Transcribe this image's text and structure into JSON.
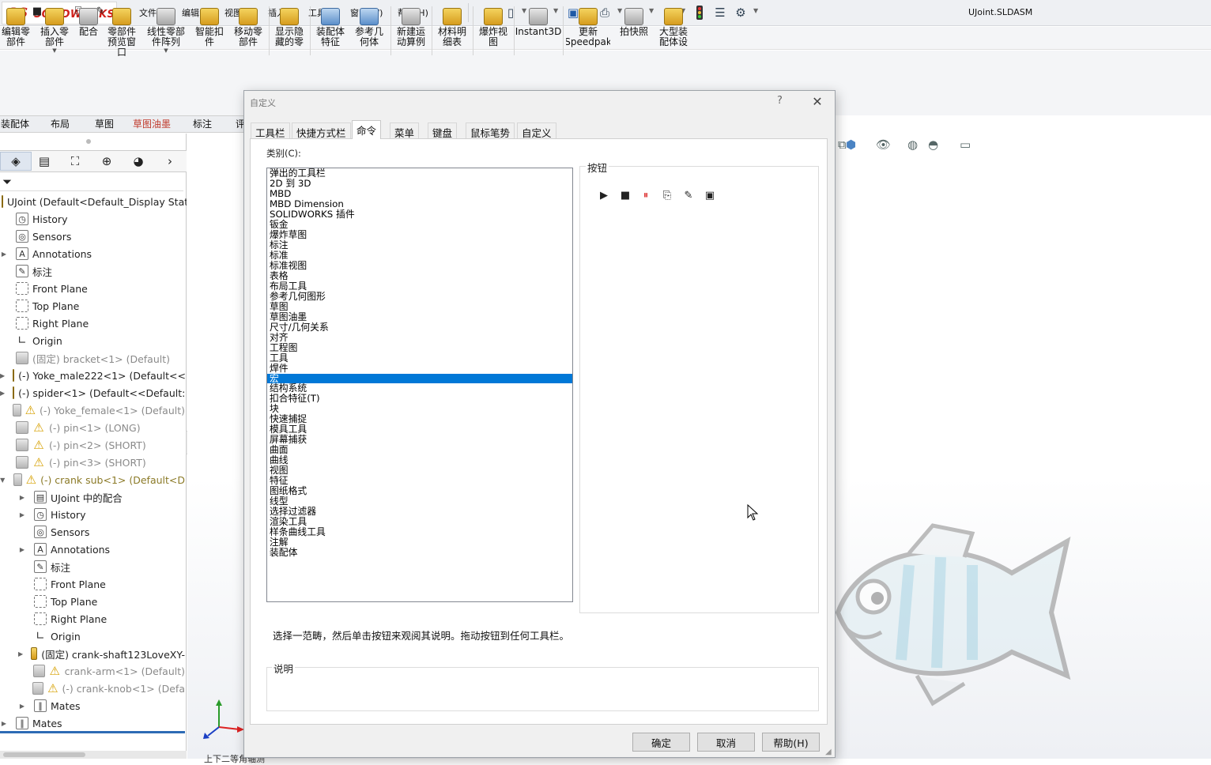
{
  "app": {
    "logo_ds": "3S",
    "logo_text": "SOLIDWORKS",
    "file_title": "UJoint.SLDASM"
  },
  "menu": [
    {
      "label": "文件(F)"
    },
    {
      "label": "编辑(E)"
    },
    {
      "label": "视图(V)"
    },
    {
      "label": "插入(I)"
    },
    {
      "label": "工具(T)"
    },
    {
      "label": "窗口(W)"
    },
    {
      "label": "帮助(H)"
    }
  ],
  "command_manager": {
    "buttons": [
      {
        "label": "编辑零\n部件"
      },
      {
        "label": "插入零\n部件"
      },
      {
        "label": "配合"
      },
      {
        "label": "零部件\n预览窗\n口"
      },
      {
        "label": "线性零部\n件阵列"
      },
      {
        "label": "智能扣\n件"
      },
      {
        "label": "移动零\n部件"
      },
      {
        "label": "显示隐\n藏的零"
      },
      {
        "label": "装配体\n特征"
      },
      {
        "label": "参考几\n何体"
      },
      {
        "label": "新建运\n动算例"
      },
      {
        "label": "材料明\n细表"
      },
      {
        "label": "爆炸视\n图"
      },
      {
        "label": "Instant3D"
      },
      {
        "label": "更新\nSpeedpak"
      },
      {
        "label": "拍快照"
      },
      {
        "label": "大型装\n配体设"
      }
    ],
    "tabs": [
      {
        "label": "装配体",
        "active": false
      },
      {
        "label": "布局",
        "active": false
      },
      {
        "label": "草图",
        "active": false
      },
      {
        "label": "草图油墨",
        "active": true
      },
      {
        "label": "标注",
        "active": false
      },
      {
        "label": "评",
        "active": false
      }
    ]
  },
  "feature_tree": {
    "root": "UJoint  (Default<Default_Display Stat",
    "items": [
      {
        "label": "History",
        "icon": "history-icon",
        "depth": 1,
        "exp": "",
        "style": ""
      },
      {
        "label": "Sensors",
        "icon": "sensors-icon",
        "depth": 1,
        "exp": "",
        "style": ""
      },
      {
        "label": "Annotations",
        "icon": "annotations-icon",
        "depth": 1,
        "exp": "▶",
        "style": ""
      },
      {
        "label": "标注",
        "icon": "markup-icon",
        "depth": 1,
        "exp": "",
        "style": ""
      },
      {
        "label": "Front Plane",
        "icon": "plane-icon",
        "depth": 1,
        "exp": "",
        "style": ""
      },
      {
        "label": "Top Plane",
        "icon": "plane-icon",
        "depth": 1,
        "exp": "",
        "style": ""
      },
      {
        "label": "Right Plane",
        "icon": "plane-icon",
        "depth": 1,
        "exp": "",
        "style": ""
      },
      {
        "label": "Origin",
        "icon": "origin-icon",
        "depth": 1,
        "exp": "",
        "style": ""
      },
      {
        "label": "(固定) bracket<1> (Default)",
        "icon": "part-icon",
        "depth": 1,
        "exp": "",
        "style": "dim"
      },
      {
        "label": "(-) Yoke_male222<1> (Default<<",
        "icon": "assembly-icon",
        "depth": 1,
        "exp": "▶",
        "style": ""
      },
      {
        "label": "(-) spider<1> (Default<<Default:",
        "icon": "assembly-icon",
        "depth": 1,
        "exp": "▶",
        "style": ""
      },
      {
        "label": "(-) Yoke_female<1> (Default)",
        "icon": "warning-icon",
        "depth": 1,
        "exp": "",
        "style": "dim"
      },
      {
        "label": "(-) pin<1> (LONG)",
        "icon": "warning-icon",
        "depth": 1,
        "exp": "",
        "style": "dim"
      },
      {
        "label": "(-) pin<2> (SHORT)",
        "icon": "warning-icon",
        "depth": 1,
        "exp": "",
        "style": "dim"
      },
      {
        "label": "(-) pin<3> (SHORT)",
        "icon": "warning-icon",
        "depth": 1,
        "exp": "",
        "style": "dim"
      },
      {
        "label": "(-) crank sub<1> (Default<D",
        "icon": "warning-icon",
        "depth": 1,
        "exp": "▼",
        "style": "olive"
      },
      {
        "label": "UJoint 中的配合",
        "icon": "mates-folder-icon",
        "depth": 2,
        "exp": "▶",
        "style": ""
      },
      {
        "label": "History",
        "icon": "history-icon",
        "depth": 2,
        "exp": "▶",
        "style": ""
      },
      {
        "label": "Sensors",
        "icon": "sensors-icon",
        "depth": 2,
        "exp": "",
        "style": ""
      },
      {
        "label": "Annotations",
        "icon": "annotations-icon",
        "depth": 2,
        "exp": "▶",
        "style": ""
      },
      {
        "label": "标注",
        "icon": "markup-icon",
        "depth": 2,
        "exp": "",
        "style": ""
      },
      {
        "label": "Front Plane",
        "icon": "plane-icon",
        "depth": 2,
        "exp": "",
        "style": ""
      },
      {
        "label": "Top Plane",
        "icon": "plane-icon",
        "depth": 2,
        "exp": "",
        "style": ""
      },
      {
        "label": "Right Plane",
        "icon": "plane-icon",
        "depth": 2,
        "exp": "",
        "style": ""
      },
      {
        "label": "Origin",
        "icon": "origin-icon",
        "depth": 2,
        "exp": "",
        "style": ""
      },
      {
        "label": "(固定) crank-shaft123LoveXY-",
        "icon": "assembly-icon",
        "depth": 2,
        "exp": "▶",
        "style": ""
      },
      {
        "label": "crank-arm<1> (Default)",
        "icon": "warning-icon",
        "depth": 2,
        "exp": "",
        "style": "dim"
      },
      {
        "label": "(-) crank-knob<1> (Defa",
        "icon": "warning-icon",
        "depth": 2,
        "exp": "",
        "style": "dim"
      },
      {
        "label": "Mates",
        "icon": "mates-icon",
        "depth": 2,
        "exp": "▶",
        "style": ""
      },
      {
        "label": "Mates",
        "icon": "mates-icon",
        "depth": 1,
        "exp": "▶",
        "style": ""
      }
    ]
  },
  "graphics": {
    "bottom_text": "上下二等角轴测"
  },
  "dialog": {
    "title": "自定义",
    "help": "?",
    "tabs": [
      {
        "label": "工具栏",
        "active": false
      },
      {
        "label": "快捷方式栏",
        "active": false
      },
      {
        "label": "命令",
        "active": true
      },
      {
        "label": "菜单",
        "active": false
      },
      {
        "label": "键盘",
        "active": false
      },
      {
        "label": "鼠标笔势",
        "active": false
      },
      {
        "label": "自定义",
        "active": false
      }
    ],
    "category_label": "类别(C):",
    "categories": [
      "弹出的工具栏",
      "2D 到 3D",
      "MBD",
      "MBD Dimension",
      "SOLIDWORKS 插件",
      "钣金",
      "爆炸草图",
      "标注",
      "标准",
      "标准视图",
      "表格",
      "布局工具",
      "参考几何图形",
      "草图",
      "草图油墨",
      "尺寸/几何关系",
      "对齐",
      "工程图",
      "工具",
      "焊件",
      "宏",
      "结构系统",
      "扣合特征(T)",
      "块",
      "快速捕捉",
      "模具工具",
      "屏幕捕获",
      "曲面",
      "曲线",
      "视图",
      "特征",
      "图纸格式",
      "线型",
      "选择过滤器",
      "渲染工具",
      "样条曲线工具",
      "注解",
      "装配体"
    ],
    "selected_category": "宏",
    "buttons_label": "按钮",
    "hint": "选择一范畴，然后单击按钮来观阅其说明。拖动按钮到任何工具栏。",
    "description_label": "说明",
    "ok": "确定",
    "cancel": "取消",
    "helpbtn": "帮助(H)"
  }
}
